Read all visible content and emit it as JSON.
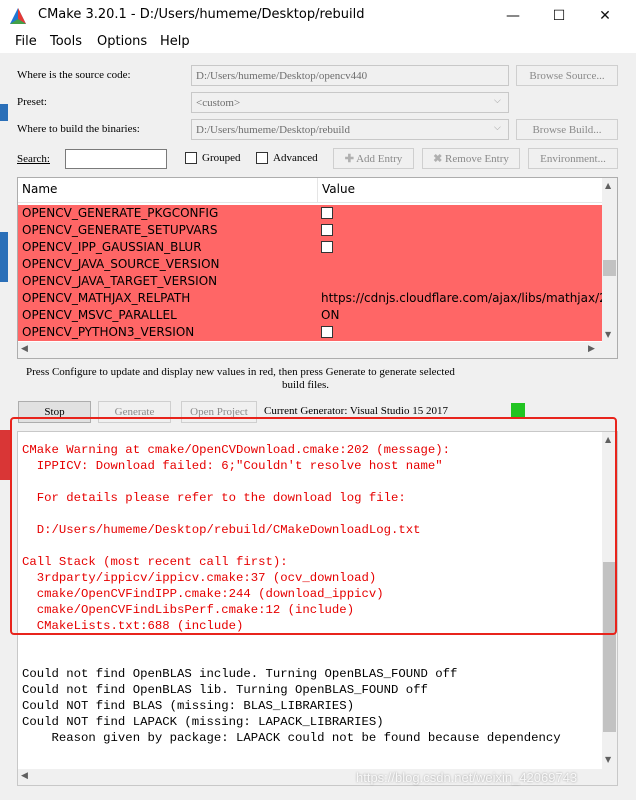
{
  "window": {
    "title": "CMake 3.20.1 - D:/Users/humeme/Desktop/rebuild",
    "minimize_glyph": "—",
    "maximize_glyph": "☐",
    "close_glyph": "✕"
  },
  "menu": {
    "file": "File",
    "tools": "Tools",
    "options": "Options",
    "help": "Help"
  },
  "source": {
    "label": "Where is the source code:",
    "value": "D:/Users/humeme/Desktop/opencv440",
    "browse": "Browse Source..."
  },
  "preset": {
    "label": "Preset:",
    "value": "<custom>"
  },
  "build": {
    "label": "Where to build the binaries:",
    "value": "D:/Users/humeme/Desktop/rebuild",
    "browse": "Browse Build..."
  },
  "search": {
    "label": "Search:",
    "value": ""
  },
  "toolbar": {
    "grouped": "Grouped",
    "advanced": "Advanced",
    "add_entry": "Add Entry",
    "remove_entry": "Remove Entry",
    "environment": "Environment..."
  },
  "table": {
    "columns": [
      "Name",
      "Value"
    ],
    "rows": [
      {
        "name": "OPENCV_GENERATE_PKGCONFIG",
        "value": "",
        "checkbox": true
      },
      {
        "name": "OPENCV_GENERATE_SETUPVARS",
        "value": "",
        "checkbox": true
      },
      {
        "name": "OPENCV_IPP_GAUSSIAN_BLUR",
        "value": "",
        "checkbox": true
      },
      {
        "name": "OPENCV_JAVA_SOURCE_VERSION",
        "value": "",
        "checkbox": false
      },
      {
        "name": "OPENCV_JAVA_TARGET_VERSION",
        "value": "",
        "checkbox": false
      },
      {
        "name": "OPENCV_MATHJAX_RELPATH",
        "value": "https://cdnjs.cloudflare.com/ajax/libs/mathjax/2.",
        "checkbox": false
      },
      {
        "name": "OPENCV_MSVC_PARALLEL",
        "value": "ON",
        "checkbox": false
      },
      {
        "name": "OPENCV_PYTHON3_VERSION",
        "value": "",
        "checkbox": true
      }
    ],
    "row_color": "#ff6666"
  },
  "hint": {
    "line1": "Press Configure to update and display new values in red, then press Generate to generate selected",
    "line2": "build files."
  },
  "actions": {
    "stop": "Stop",
    "generate": "Generate",
    "open_project": "Open Project",
    "generator_label": "Current Generator: Visual Studio 15 2017"
  },
  "output": {
    "warning_lines": [
      "CMake Warning at cmake/OpenCVDownload.cmake:202 (message):",
      "  IPPICV: Download failed: 6;\"Couldn't resolve host name\"",
      "",
      "  For details please refer to the download log file:",
      "",
      "  D:/Users/humeme/Desktop/rebuild/CMakeDownloadLog.txt",
      "",
      "Call Stack (most recent call first):",
      "  3rdparty/ippicv/ippicv.cmake:37 (ocv_download)",
      "  cmake/OpenCVFindIPP.cmake:244 (download_ippicv)",
      "  cmake/OpenCVFindLibsPerf.cmake:12 (include)",
      "  CMakeLists.txt:688 (include)"
    ],
    "normal_lines": [
      "Could not find OpenBLAS include. Turning OpenBLAS_FOUND off",
      "Could not find OpenBLAS lib. Turning OpenBLAS_FOUND off",
      "Could NOT find BLAS (missing: BLAS_LIBRARIES)",
      "Could NOT find LAPACK (missing: LAPACK_LIBRARIES)",
      "    Reason given by package: LAPACK could not be found because dependency"
    ],
    "warning_color": "#e60000",
    "highlight_color": "#e8241c"
  },
  "watermark": "https://blog.csdn.net/weixin_42069743"
}
